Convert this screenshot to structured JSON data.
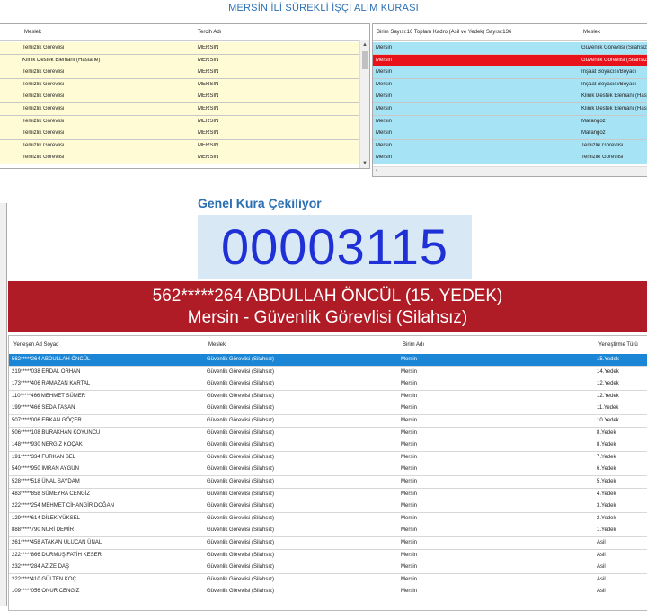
{
  "app": {
    "title": "MERSİN İLİ SÜREKLİ İŞÇİ ALIM KURASI"
  },
  "left_table": {
    "headers": [
      "Meslek",
      "Tercih Adı"
    ],
    "rows": [
      [
        "Temizlik Görevlisi",
        "MERSIN"
      ],
      [
        "Klinik Destek Elemanı (Hastane)",
        "MERSIN"
      ],
      [
        "Temizlik Görevlisi",
        "MERSIN"
      ],
      [
        "Temizlik Görevlisi",
        "MERSIN"
      ],
      [
        "Temizlik Görevlisi",
        "MERSIN"
      ],
      [
        "Temizlik Görevlisi",
        "MERSIN"
      ],
      [
        "Temizlik Görevlisi",
        "MERSIN"
      ],
      [
        "Temizlik Görevlisi",
        "MERSIN"
      ],
      [
        "Temizlik Görevlisi",
        "MERSIN"
      ],
      [
        "Temizlik Görevlisi",
        "MERSIN"
      ]
    ]
  },
  "right_table": {
    "headers": [
      "Birim Sayısı:16 Toplam Kadro (Asil ve Yedek) Sayısı:136",
      "Meslek"
    ],
    "rows": [
      [
        "Mersin",
        "Güvenlik Görevlisi (Silahsız)"
      ],
      [
        "Mersin",
        "Güvenlik Görevlisi (Silahsız)"
      ],
      [
        "Mersin",
        "İnşaat Boyacısı/Boyacı"
      ],
      [
        "Mersin",
        "İnşaat Boyacısı/Boyacı"
      ],
      [
        "Mersin",
        "Klinik Destek Elemanı (Hastane)"
      ],
      [
        "Mersin",
        "Klinik Destek Elemanı (Hastane)"
      ],
      [
        "Mersin",
        "Marangoz"
      ],
      [
        "Mersin",
        "Marangoz"
      ],
      [
        "Mersin",
        "Temizlik Görevlisi"
      ],
      [
        "Mersin",
        "Temizlik Görevlisi"
      ]
    ],
    "selected_index": 1
  },
  "draw": {
    "label": "Genel Kura Çekiliyor",
    "number": "00003115",
    "winner_line1": "562*****264 ABDULLAH ÖNCÜL (15. YEDEK)",
    "winner_line2": "Mersin - Güvenlik Görevlisi (Silahsız)"
  },
  "results_table": {
    "headers": [
      "Yerleşen Ad Soyad",
      "Meslek",
      "Birim Adı",
      "Yerleştirme Türü"
    ],
    "rows": [
      [
        "562*****264 ABDULLAH ÖNCÜL",
        "Güvenlik Görevlisi (Silahsız)",
        "Mersin",
        "15.Yedek"
      ],
      [
        "219*****038 ERDAL ORHAN",
        "Güvenlik Görevlisi (Silahsız)",
        "Mersin",
        "14.Yedek"
      ],
      [
        "173*****406 RAMAZAN KARTAL",
        "Güvenlik Görevlisi (Silahsız)",
        "Mersin",
        "12.Yedek"
      ],
      [
        "110*****466 MEHMET SÜMER",
        "Güvenlik Görevlisi (Silahsız)",
        "Mersin",
        "12.Yedek"
      ],
      [
        "199*****466 SEDA TAŞAN",
        "Güvenlik Görevlisi (Silahsız)",
        "Mersin",
        "11.Yedek"
      ],
      [
        "507*****006 ERKAN GÖÇER",
        "Güvenlik Görevlisi (Silahsız)",
        "Mersin",
        "10.Yedek"
      ],
      [
        "506*****108 BURAKHAN KOYUNCU",
        "Güvenlik Görevlisi (Silahsız)",
        "Mersin",
        "8.Yedek"
      ],
      [
        "148*****930 NERGİZ KOÇAK",
        "Güvenlik Görevlisi (Silahsız)",
        "Mersin",
        "8.Yedek"
      ],
      [
        "191*****334 FURKAN SEL",
        "Güvenlik Görevlisi (Silahsız)",
        "Mersin",
        "7.Yedek"
      ],
      [
        "540*****950 İMRAN AYGÜN",
        "Güvenlik Görevlisi (Silahsız)",
        "Mersin",
        "6.Yedek"
      ],
      [
        "528*****518 ÜNAL SAYDAM",
        "Güvenlik Görevlisi (Silahsız)",
        "Mersin",
        "5.Yedek"
      ],
      [
        "483*****858 SÜMEYRA CENGİZ",
        "Güvenlik Görevlisi (Silahsız)",
        "Mersin",
        "4.Yedek"
      ],
      [
        "222*****254 MEHMET CİHANGİR DOĞAN",
        "Güvenlik Görevlisi (Silahsız)",
        "Mersin",
        "3.Yedek"
      ],
      [
        "129*****614 DİLEK YÜKSEL",
        "Güvenlik Görevlisi (Silahsız)",
        "Mersin",
        "2.Yedek"
      ],
      [
        "888*****790 NURİ DEMİR",
        "Güvenlik Görevlisi (Silahsız)",
        "Mersin",
        "1.Yedek"
      ],
      [
        "261*****458 ATAKAN ULUCAN ÜNAL",
        "Güvenlik Görevlisi (Silahsız)",
        "Mersin",
        "Asil"
      ],
      [
        "222*****866 DURMUŞ FATİH KESER",
        "Güvenlik Görevlisi (Silahsız)",
        "Mersin",
        "Asil"
      ],
      [
        "232*****284 AZİZE DAŞ",
        "Güvenlik Görevlisi (Silahsız)",
        "Mersin",
        "Asil"
      ],
      [
        "222*****410 GÜLTEN KOÇ",
        "Güvenlik Görevlisi (Silahsız)",
        "Mersin",
        "Asil"
      ],
      [
        "109*****056 ONUR CENGİZ",
        "Güvenlik Görevlisi (Silahsız)",
        "Mersin",
        "Asil"
      ]
    ],
    "selected_index": 0
  },
  "colors": {
    "title": "#2a6fb4",
    "counter": "#1e30d6",
    "banner": "#b01c26",
    "left_rows": "#fffbd4",
    "right_rows": "#a6e3f5",
    "right_selected": "#e8121a",
    "results_selected": "#1b86d6"
  }
}
